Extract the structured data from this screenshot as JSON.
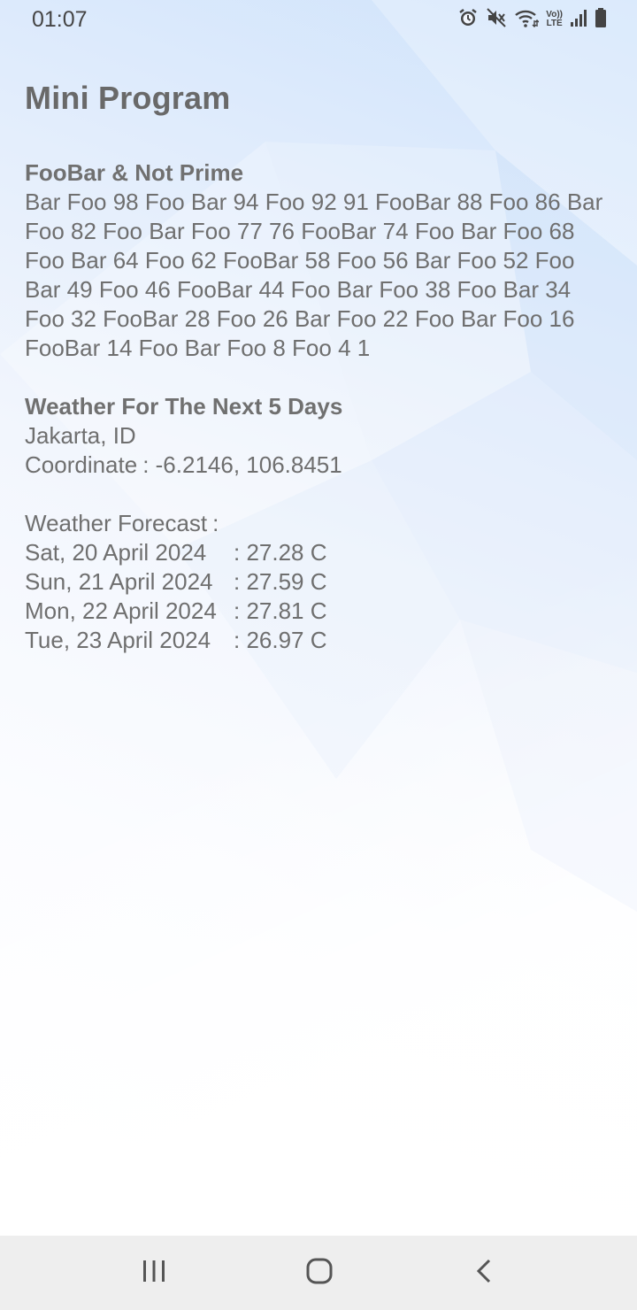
{
  "status_bar": {
    "time": "01:07",
    "icons": [
      "alarm-icon",
      "mute-icon",
      "wifi-icon",
      "volte-icon",
      "signal-icon",
      "battery-icon"
    ],
    "volte_top": "Vo))",
    "volte_bottom": "LTE"
  },
  "app": {
    "title": "Mini Program"
  },
  "foobar": {
    "title": "FooBar & Not Prime",
    "text": "Bar Foo 98 Foo Bar 94 Foo 92 91 FooBar 88 Foo 86 Bar Foo 82 Foo Bar Foo 77 76 FooBar 74 Foo Bar Foo 68 Foo Bar 64 Foo 62 FooBar 58 Foo 56 Bar Foo 52 Foo Bar 49 Foo 46 FooBar 44 Foo Bar Foo 38 Foo Bar 34 Foo 32 FooBar 28 Foo 26 Bar Foo 22 Foo Bar Foo 16 FooBar 14 Foo Bar Foo 8 Foo 4 1"
  },
  "weather": {
    "title": "Weather For The Next 5 Days",
    "location": "Jakarta, ID",
    "coordinate_label": "Coordinate",
    "coordinate_value": ": -6.2146, 106.8451",
    "forecast_label": "Weather Forecast",
    "forecast_colon": ":",
    "forecast": [
      {
        "date": "Sat, 20 April 2024",
        "temp": ": 27.28 C"
      },
      {
        "date": "Sun, 21 April 2024",
        "temp": ": 27.59 C"
      },
      {
        "date": "Mon, 22 April 2024",
        "temp": ": 27.81 C"
      },
      {
        "date": "Tue, 23 April 2024",
        "temp": ": 26.97 C"
      }
    ]
  },
  "nav_bar": {
    "buttons": [
      "recent-apps-icon",
      "home-icon",
      "back-icon"
    ]
  },
  "colors": {
    "text": "#707070",
    "nav_background": "#eeeeee",
    "background_accent": "#cfe3fb"
  }
}
